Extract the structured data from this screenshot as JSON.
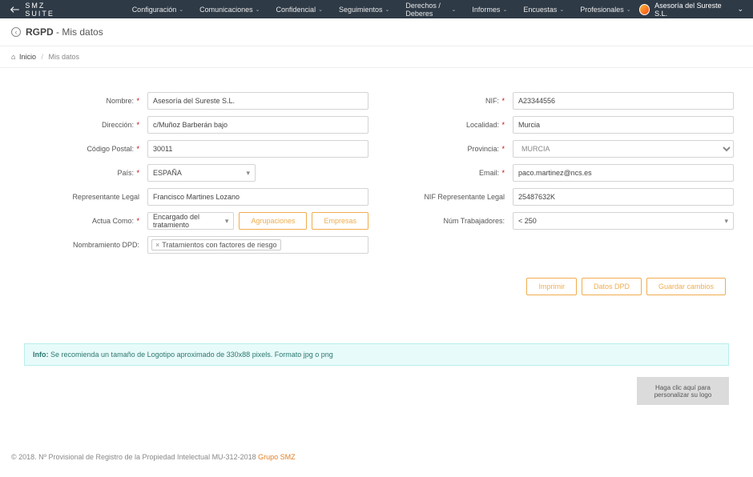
{
  "brand": "SMZ SUITE",
  "nav": [
    {
      "label": "Configuración"
    },
    {
      "label": "Comunicaciones"
    },
    {
      "label": "Confidencial"
    },
    {
      "label": "Seguimientos"
    },
    {
      "label": "Derechos / Deberes"
    },
    {
      "label": "Informes"
    },
    {
      "label": "Encuestas"
    },
    {
      "label": "Profesionales"
    }
  ],
  "user": {
    "company": "Asesoría del Sureste S.L."
  },
  "page": {
    "prefix": "RGPD",
    "suffix": "Mis datos"
  },
  "breadcrumb": {
    "home": "Inicio",
    "current": "Mis datos"
  },
  "labels": {
    "nombre": "Nombre:",
    "direccion": "Dirección:",
    "cp": "Código Postal:",
    "pais": "País:",
    "rep": "Representante Legal",
    "actua": "Actua Como:",
    "dpd": "Nombramiento DPD:",
    "nif": "NIF:",
    "localidad": "Localidad:",
    "provincia": "Provincia:",
    "email": "Email:",
    "nifrep": "NIF Representante Legal",
    "numtrab": "Núm Trabajadores:"
  },
  "values": {
    "nombre": "Asesoría del Sureste S.L.",
    "direccion": "c/Muñoz Barberán bajo",
    "cp": "30011",
    "pais": "ESPAÑA",
    "rep": "Francisco Martines Lozano",
    "actua": "Encargado del tratamiento",
    "dpd_tag": "Tratamientos con factores de riesgo",
    "nif": "A23344556",
    "localidad": "Murcia",
    "provincia": "MURCIA",
    "email": "paco.martinez@ncs.es",
    "nifrep": "25487632K",
    "numtrab": "< 250"
  },
  "buttons": {
    "agrupaciones": "Agrupaciones",
    "empresas": "Empresas",
    "imprimir": "Imprimir",
    "datosdpd": "Datos DPD",
    "guardar": "Guardar cambios"
  },
  "info": {
    "prefix": "Info:",
    "text": "Se recomienda un tamaño de Logotipo aproximado de 330x88 pixels. Formato jpg o png"
  },
  "logodrop": "Haga clic aquí para personalizar su logo",
  "footer": {
    "copy": "© 2018. Nº Provisional de Registro de la Propiedad Intelectual MU-312-2018 ",
    "grupo": "Grupo SMZ"
  }
}
